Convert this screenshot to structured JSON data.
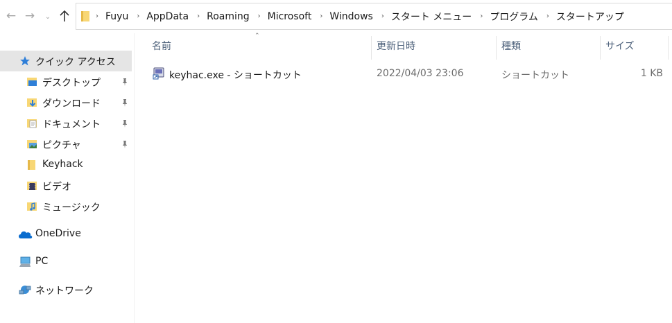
{
  "address": {
    "crumbs": [
      "Fuyu",
      "AppData",
      "Roaming",
      "Microsoft",
      "Windows",
      "スタート メニュー",
      "プログラム",
      "スタートアップ"
    ]
  },
  "nav": {
    "back_icon": "arrow-left-icon",
    "forward_icon": "arrow-right-icon",
    "recent_icon": "chevron-down-icon",
    "up_icon": "arrow-up-icon"
  },
  "sidebar": {
    "quick_access": "クイック アクセス",
    "items": [
      {
        "label": "デスクトップ",
        "icon": "desktop-folder-icon",
        "pinned": true
      },
      {
        "label": "ダウンロード",
        "icon": "downloads-folder-icon",
        "pinned": true
      },
      {
        "label": "ドキュメント",
        "icon": "documents-folder-icon",
        "pinned": true
      },
      {
        "label": "ピクチャ",
        "icon": "pictures-folder-icon",
        "pinned": true
      },
      {
        "label": "Keyhack",
        "icon": "folder-icon",
        "pinned": false
      },
      {
        "label": "ビデオ",
        "icon": "videos-folder-icon",
        "pinned": false
      },
      {
        "label": "ミュージック",
        "icon": "music-folder-icon",
        "pinned": false
      }
    ],
    "onedrive": "OneDrive",
    "pc": "PC",
    "network": "ネットワーク"
  },
  "columns": {
    "name": "名前",
    "date": "更新日時",
    "type": "種類",
    "size": "サイズ"
  },
  "files": [
    {
      "name": "keyhac.exe - ショートカット",
      "date": "2022/04/03 23:06",
      "type": "ショートカット",
      "size": "1 KB",
      "icon": "shortcut-icon"
    }
  ],
  "colors": {
    "selected_bg": "#e5e5e5",
    "header_text": "#4c607a",
    "folder_yellow": "#f8d775",
    "onedrive_blue": "#0a6cce"
  }
}
